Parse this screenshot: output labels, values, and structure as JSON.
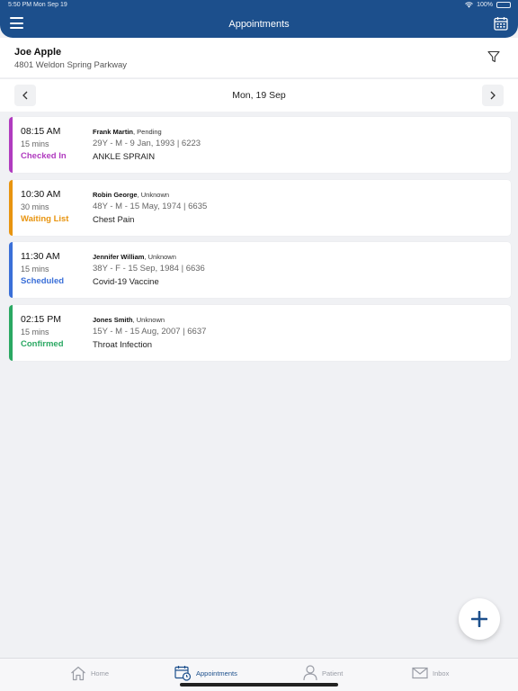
{
  "status_bar": {
    "time_date": "5:50 PM   Mon Sep 19",
    "battery": "100%",
    "battery_level": 1.0
  },
  "header": {
    "title": "Appointments"
  },
  "patient": {
    "name": "Joe Apple",
    "address": "4801 Weldon Spring Parkway"
  },
  "date_nav": {
    "label": "Mon, 19 Sep"
  },
  "appointments": [
    {
      "time": "08:15 AM",
      "duration": "15 mins",
      "status": "Checked In",
      "status_color": "#b03bbf",
      "doctor": "Frank Martin",
      "doctor_status": ", Pending",
      "demographics": "29Y - M - 9 Jan, 1993 | 6223",
      "reason": "ANKLE SPRAIN"
    },
    {
      "time": "10:30 AM",
      "duration": "30 mins",
      "status": "Waiting List",
      "status_color": "#e8940f",
      "doctor": "Robin George",
      "doctor_status": ", Unknown",
      "demographics": "48Y - M - 15 May, 1974 | 6635",
      "reason": "Chest Pain"
    },
    {
      "time": "11:30 AM",
      "duration": "15 mins",
      "status": "Scheduled",
      "status_color": "#3a6fd8",
      "doctor": "Jennifer William",
      "doctor_status": ", Unknown",
      "demographics": "38Y - F - 15 Sep, 1984 | 6636",
      "reason": "Covid-19 Vaccine"
    },
    {
      "time": "02:15 PM",
      "duration": "15 mins",
      "status": "Confirmed",
      "status_color": "#2aa862",
      "doctor": "Jones Smith",
      "doctor_status": ", Unknown",
      "demographics": "15Y - M - 15 Aug, 2007 | 6637",
      "reason": "Throat Infection"
    }
  ],
  "tabs": [
    {
      "label": "Home",
      "icon": "home-icon"
    },
    {
      "label": "Appointments",
      "icon": "calendar-clock-icon"
    },
    {
      "label": "Patient",
      "icon": "person-icon"
    },
    {
      "label": "Inbox",
      "icon": "mail-icon"
    }
  ],
  "colors": {
    "brand": "#1c4f8c",
    "background": "#f0f1f4"
  }
}
